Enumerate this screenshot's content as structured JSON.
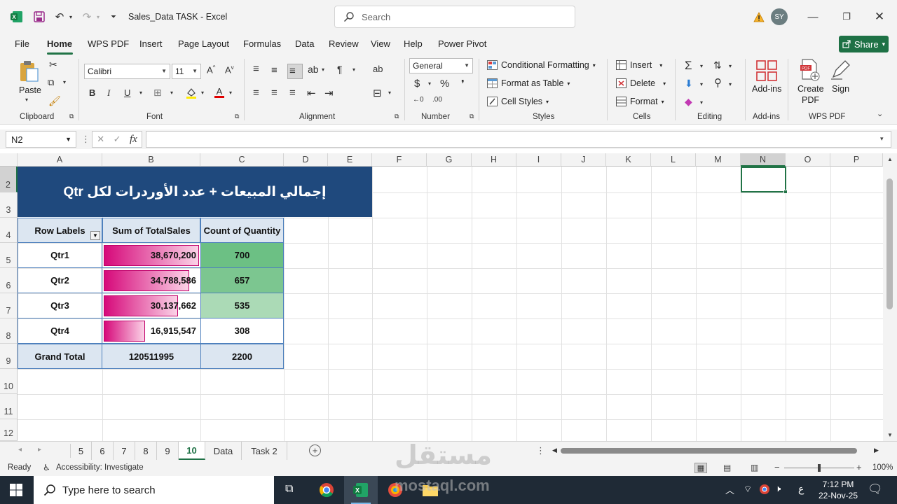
{
  "window": {
    "file_name": "Sales_Data TASK",
    "app_name": "Excel",
    "title_sep": " - ",
    "search_placeholder": "Search",
    "user_initials": "SY",
    "accent_color": "#217346"
  },
  "menu": {
    "items": [
      "File",
      "Home",
      "WPS PDF",
      "Insert",
      "Page Layout",
      "Formulas",
      "Data",
      "Review",
      "View",
      "Help",
      "Power Pivot"
    ],
    "active": "Home",
    "share_label": "Share"
  },
  "ribbon": {
    "clipboard": {
      "paste": "Paste",
      "label": "Clipboard"
    },
    "font": {
      "family": "Calibri",
      "size": "11",
      "label": "Font"
    },
    "alignment": {
      "label": "Alignment"
    },
    "number": {
      "format": "General",
      "label": "Number"
    },
    "styles": {
      "conditional": "Conditional Formatting",
      "table": "Format as Table",
      "cell_styles": "Cell Styles",
      "label": "Styles"
    },
    "cells": {
      "insert": "Insert",
      "delete": "Delete",
      "format": "Format",
      "label": "Cells"
    },
    "editing": {
      "label": "Editing"
    },
    "addins": {
      "btn": "Add-ins",
      "label": "Add-ins"
    },
    "wps": {
      "create_line1": "Create",
      "create_line2": "PDF",
      "sign": "Sign",
      "label": "WPS PDF"
    }
  },
  "formula_bar": {
    "name_box": "N2",
    "fx": "fx",
    "content": ""
  },
  "columns": [
    "A",
    "B",
    "C",
    "D",
    "E",
    "F",
    "G",
    "H",
    "I",
    "J",
    "K",
    "L",
    "M",
    "N",
    "O",
    "P"
  ],
  "rows": [
    "2",
    "3",
    "4",
    "5",
    "6",
    "7",
    "8",
    "9",
    "10",
    "11",
    "12"
  ],
  "pivot": {
    "banner_title": "إجمالي المبيعات + عدد الأوردرات لكل Qtr",
    "headers": {
      "row_labels": "Row Labels",
      "sum_sales": "Sum of TotalSales",
      "count_qty": "Count of Quantity"
    },
    "rows": [
      {
        "label": "Qtr1",
        "sales": "38,670,200",
        "sales_value": 38670200,
        "qty": "700",
        "qty_color": "#6cc084"
      },
      {
        "label": "Qtr2",
        "sales": "34,788,586",
        "sales_value": 34788586,
        "qty": "657",
        "qty_color": "#7cc690"
      },
      {
        "label": "Qtr3",
        "sales": "30,137,662",
        "sales_value": 30137662,
        "qty": "535",
        "qty_color": "#abdab6"
      },
      {
        "label": "Qtr4",
        "sales": "16,915,547",
        "sales_value": 16915547,
        "qty": "308",
        "qty_color": "#ffffff"
      }
    ],
    "grand_total": {
      "label": "Grand Total",
      "sales": "120511995",
      "qty": "2200"
    },
    "header_fill": "#dce6f1",
    "banner_fill": "#1f497d"
  },
  "sheet_tabs": [
    "5",
    "6",
    "7",
    "8",
    "9",
    "10",
    "Data",
    "Task 2"
  ],
  "active_tab": "10",
  "status": {
    "ready": "Ready",
    "accessibility": "Accessibility: Investigate",
    "zoom": "100%"
  },
  "taskbar": {
    "search_placeholder": "Type here to search",
    "time": "7:12 PM",
    "date": "22-Nov-25",
    "lang": "ع"
  },
  "watermark": {
    "arabic": "مستقل",
    "latin": "mostaql.com"
  }
}
